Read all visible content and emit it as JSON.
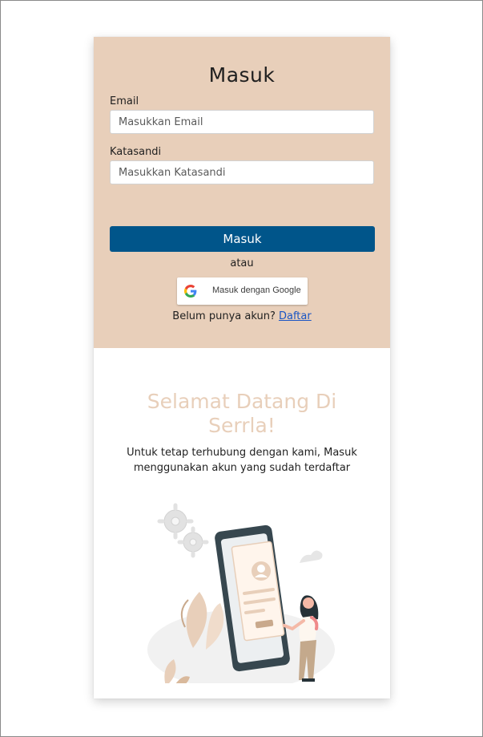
{
  "login": {
    "title": "Masuk",
    "email_label": "Email",
    "email_placeholder": "Masukkan Email",
    "password_label": "Katasandi",
    "password_placeholder": "Masukkan Katasandi",
    "submit_label": "Masuk",
    "or_text": "atau",
    "google_label": "Masuk dengan Google",
    "signup_prompt": "Belum punya akun?",
    "signup_link": "Daftar"
  },
  "welcome": {
    "title": "Selamat Datang Di Serrla!",
    "subtitle": "Untuk tetap terhubung dengan kami, Masuk menggunakan akun yang sudah terdaftar"
  },
  "colors": {
    "panel_bg": "#e8cfba",
    "primary_button": "#00558a",
    "link": "#1a55c4",
    "welcome_title": "#e8cfba"
  }
}
